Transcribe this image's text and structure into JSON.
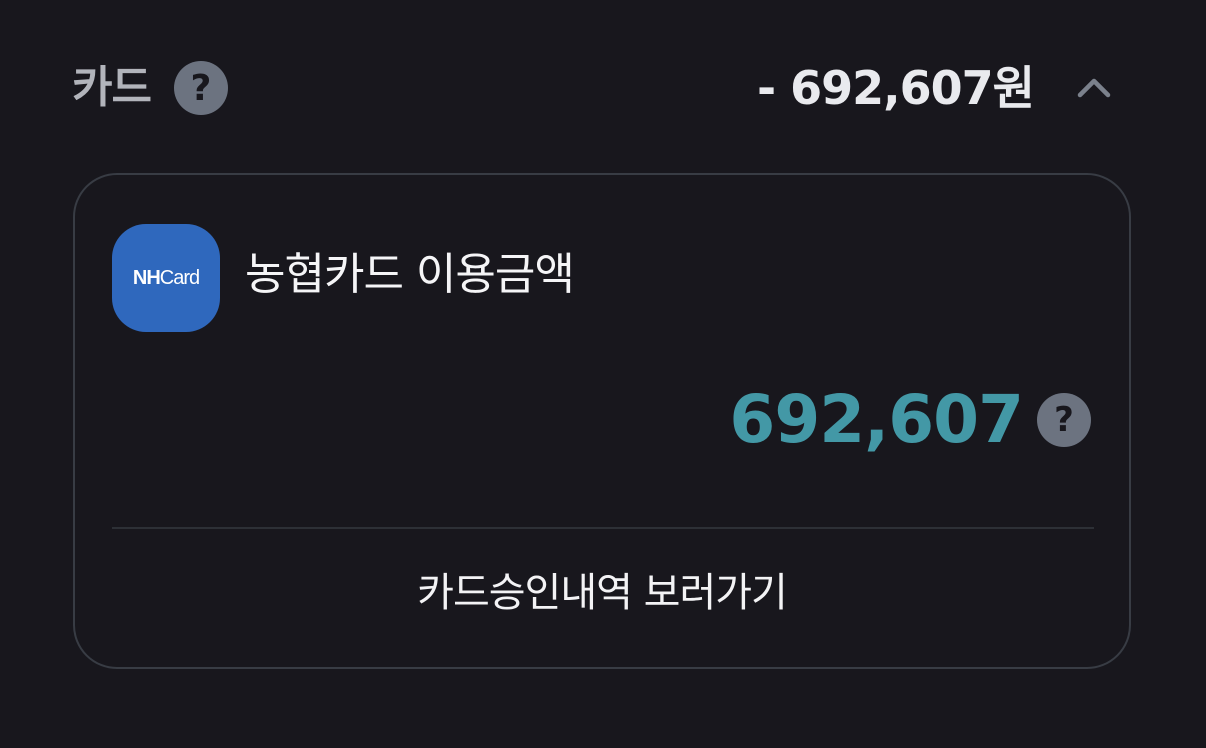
{
  "section": {
    "title": "카드",
    "help_icon": "question-mark-icon",
    "total_amount": "- 692,607원",
    "collapse_icon": "chevron-up-icon"
  },
  "card": {
    "logo": {
      "brand_bold": "NH",
      "brand_regular": "Card",
      "color": "#2f68bd"
    },
    "name": "농협카드 이용금액",
    "amount": "692,607",
    "amount_color": "#4398a6",
    "help_icon": "question-mark-icon",
    "history_link": "카드승인내역 보러가기"
  }
}
